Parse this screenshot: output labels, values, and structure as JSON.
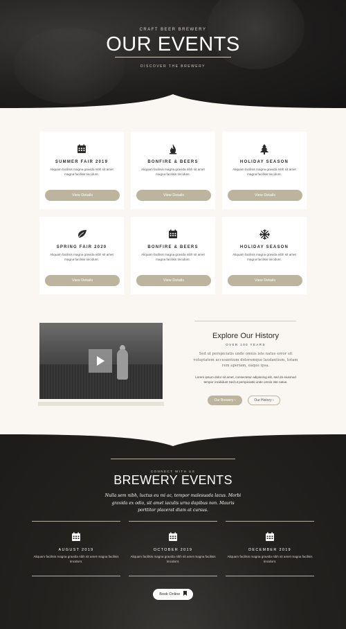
{
  "hero": {
    "eyebrow": "CRAFT BEER BREWERY",
    "title": "OUR EVENTS",
    "tagline": "DISCOVER THE BREWERY"
  },
  "events": [
    {
      "icon": "calendar-icon",
      "title": "SUMMER FAIR 2019",
      "text": "Aliquam facilisis magna gravida nibh sit amet magna facilisis tincidunt.",
      "button": "View Details"
    },
    {
      "icon": "fire-icon",
      "title": "BONFIRE & BEERS",
      "text": "Aliquam facilisis magna gravida nibh sit amet magna facilisis tincidunt.",
      "button": "View Details"
    },
    {
      "icon": "tree-icon",
      "title": "HOLIDAY SEASON",
      "text": "Aliquam facilisis magna gravida nibh sit amet magna facilisis tincidunt.",
      "button": "View Details"
    },
    {
      "icon": "leaf-icon",
      "title": "SPRING FAIR 2020",
      "text": "Aliquam facilisis magna gravida nibh sit amet magna facilisis tincidunt.",
      "button": "View Details"
    },
    {
      "icon": "calendar-icon",
      "title": "BONFIRE & BEERS",
      "text": "Aliquam facilisis magna gravida nibh sit amet magna facilisis tincidunt.",
      "button": "View Details"
    },
    {
      "icon": "snowflake-icon",
      "title": "HOLIDAY SEASON",
      "text": "Aliquam facilisis magna gravida nibh sit amet magna facilisis tincidunt.",
      "button": "View Details"
    }
  ],
  "history": {
    "title": "Explore Our History",
    "subtitle": "OVER 100 YEARS",
    "quote": "Sed ut perspiciatis unde omnis iste natus error sit voluptatem accusantium doloremque laudantium, totam rem aperiam, eaque ipsa.",
    "text": "Lorem ipsum dolor sit amet, consectetur adipiscing elit, sed do eiusmod tempor incididunt Sed ut perspiciatis unde omnis iste natus.",
    "primary_button": "Our Brewery",
    "secondary_button": "Our History"
  },
  "footer": {
    "eyebrow": "CONNECT WITH US",
    "title": "BREWERY EVENTS",
    "quote": "Nulla sem nibh, luctus eu mi ac, tempor malesuada lacus. Morbi gravida ex odio, sit amet iaculis urna dapibus non. Mauris porttitor placerat diam at cursus.",
    "columns": [
      {
        "date": "AUGUST 2019",
        "text": "Aliquam facilisis magna gravida nibh sit amet magna facilisis tincidunt."
      },
      {
        "date": "OCTOBER 2019",
        "text": "Aliquam facilisis magna gravida nibh sit amet magna facilisis tincidunt."
      },
      {
        "date": "DECEMBER 2019",
        "text": "Aliquam facilisis magna gravida nibh sit amet magna facilisis tincidunt."
      }
    ],
    "book_button": "Book Online"
  },
  "colors": {
    "accent": "#bcb49c",
    "cream": "#faf7f2",
    "dark": "#1f1e1d"
  }
}
